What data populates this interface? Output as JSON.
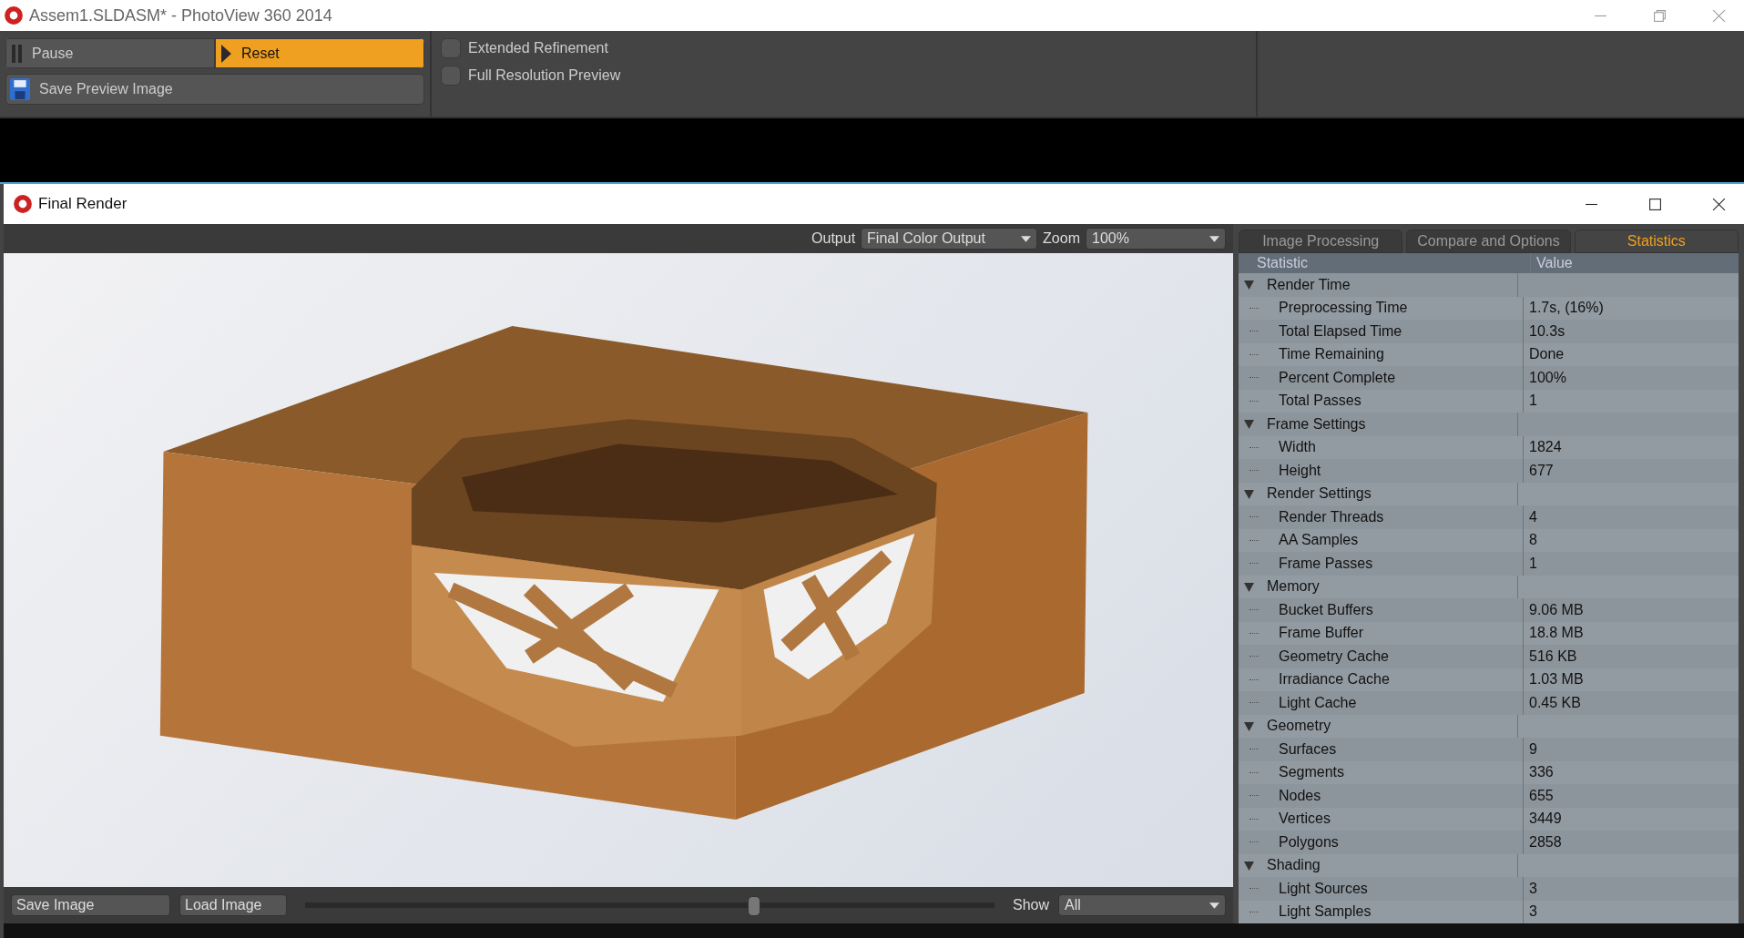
{
  "window": {
    "title": "Assem1.SLDASM* - PhotoView 360 2014"
  },
  "toolbar": {
    "buttons": [
      {
        "label": "Pause",
        "kind": "pause",
        "selected": false
      },
      {
        "label": "Reset",
        "kind": "reset",
        "selected": true
      }
    ],
    "save_button": "Save Preview Image",
    "checkboxes": [
      {
        "label": "Extended Refinement",
        "checked": false
      },
      {
        "label": "Full Resolution Preview",
        "checked": false
      }
    ]
  },
  "render_window": {
    "title": "Final Render",
    "output_label": "Output",
    "output_value": "Final Color Output",
    "zoom_label": "Zoom",
    "zoom_value": "100%",
    "tabs": [
      {
        "label": "Image Processing",
        "selected": false
      },
      {
        "label": "Compare and Options",
        "selected": false
      },
      {
        "label": "Statistics",
        "selected": true
      }
    ],
    "table": {
      "columns": [
        "Statistic",
        "Value"
      ],
      "groups": [
        {
          "name": "Render Time",
          "expanded": true,
          "children": [
            {
              "name": "Preprocessing Time",
              "value": "1.7s, (16%)"
            },
            {
              "name": "Total Elapsed Time",
              "value": "10.3s"
            },
            {
              "name": "Time Remaining",
              "value": "Done"
            },
            {
              "name": "Percent Complete",
              "value": "100%"
            },
            {
              "name": "Total Passes",
              "value": "1"
            }
          ]
        },
        {
          "name": "Frame Settings",
          "expanded": true,
          "children": [
            {
              "name": "Width",
              "value": "1824"
            },
            {
              "name": "Height",
              "value": "677"
            }
          ]
        },
        {
          "name": "Render Settings",
          "expanded": true,
          "children": [
            {
              "name": "Render Threads",
              "value": "4"
            },
            {
              "name": "AA Samples",
              "value": "8"
            },
            {
              "name": "Frame Passes",
              "value": "1"
            }
          ]
        },
        {
          "name": "Memory",
          "expanded": true,
          "children": [
            {
              "name": "Bucket Buffers",
              "value": "9.06 MB"
            },
            {
              "name": "Frame Buffer",
              "value": "18.8 MB"
            },
            {
              "name": "Geometry Cache",
              "value": "516 KB"
            },
            {
              "name": "Irradiance Cache",
              "value": "1.03 MB"
            },
            {
              "name": "Light Cache",
              "value": "0.45 KB"
            }
          ]
        },
        {
          "name": "Geometry",
          "expanded": true,
          "children": [
            {
              "name": "Surfaces",
              "value": "9"
            },
            {
              "name": "Segments",
              "value": "336"
            },
            {
              "name": "Nodes",
              "value": "655"
            },
            {
              "name": "Vertices",
              "value": "3449"
            },
            {
              "name": "Polygons",
              "value": "2858"
            }
          ]
        },
        {
          "name": "Shading",
          "expanded": true,
          "children": [
            {
              "name": "Light Sources",
              "value": "3"
            },
            {
              "name": "Light Samples",
              "value": "3"
            }
          ]
        }
      ]
    },
    "bottom": {
      "save_image": "Save Image",
      "load_image": "Load Image",
      "slider": {
        "level": 0.65
      },
      "show_label": "Show",
      "show_value": "All"
    }
  }
}
